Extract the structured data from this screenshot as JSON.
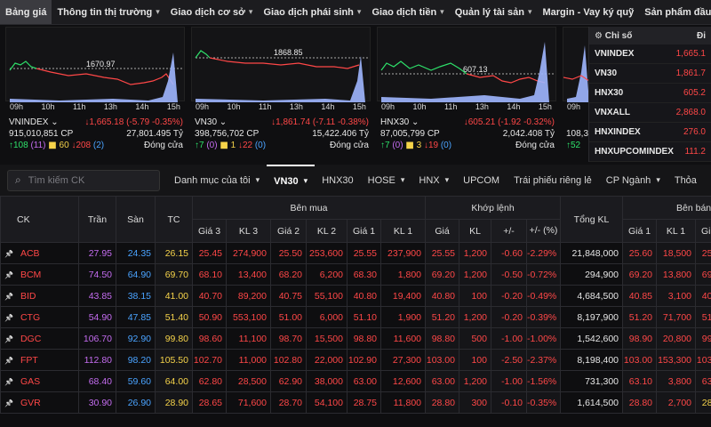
{
  "nav": [
    {
      "label": "Bảng giá",
      "active": true,
      "chevron": false
    },
    {
      "label": "Thông tin thị trường",
      "chevron": true
    },
    {
      "label": "Giao dịch cơ sở",
      "chevron": true
    },
    {
      "label": "Giao dịch phái sinh",
      "chevron": true
    },
    {
      "label": "Giao dịch tiền",
      "chevron": true
    },
    {
      "label": "Quản lý tài sản",
      "chevron": true
    },
    {
      "label": "Margin - Vay ký quỹ",
      "chevron": false
    },
    {
      "label": "Sản phẩm đầu tư",
      "chevron": false
    }
  ],
  "panels": [
    {
      "name": "VNINDEX",
      "ref_label": "1670.97",
      "change": "↓1,665.18 (-5.79 -0.35%)",
      "volume": "915,010,851 CP",
      "value": "27,801.495 Tỷ",
      "adv": "↑108",
      "adv_ceiling": "(11)",
      "unch": "60",
      "dec": "↓208",
      "dec_floor": "(2)",
      "status": "Đóng cửa",
      "times": [
        "09h",
        "10h",
        "11h",
        "13h",
        "14h",
        "15h"
      ]
    },
    {
      "name": "VN30",
      "ref_label": "1868.85",
      "change": "↓1,861.74 (-7.11 -0.38%)",
      "volume": "398,756,702 CP",
      "value": "15,422.406 Tỷ",
      "adv": "↑7",
      "adv_ceiling": "(0)",
      "unch": "1",
      "dec": "↓22",
      "dec_floor": "(0)",
      "status": "Đóng cửa",
      "times": [
        "09h",
        "10h",
        "11h",
        "13h",
        "14h",
        "15h"
      ]
    },
    {
      "name": "HNX30",
      "ref_label": "607.13",
      "change": "↓605.21 (-1.92 -0.32%)",
      "volume": "87,005,799 CP",
      "value": "2,042.408 Tỷ",
      "adv": "↑7",
      "adv_ceiling": "(0)",
      "unch": "3",
      "dec": "↓19",
      "dec_floor": "(0)",
      "status": "Đóng cửa",
      "times": [
        "09h",
        "10h",
        "11h",
        "13h",
        "14h",
        "15h"
      ]
    },
    {
      "name": "",
      "ref_label": "",
      "change": "",
      "volume": "108,3",
      "value": "",
      "adv": "↑52",
      "adv_ceiling": "",
      "unch": "",
      "dec": "",
      "dec_floor": "",
      "status": "",
      "times": [
        "09h",
        "",
        ""
      ]
    }
  ],
  "side": {
    "header": "Chỉ số",
    "header_right": "Đi",
    "rows": [
      {
        "name": "VNINDEX",
        "value": "1,665.1"
      },
      {
        "name": "VN30",
        "value": "1,861.7"
      },
      {
        "name": "HNX30",
        "value": "605.2"
      },
      {
        "name": "VNXALL",
        "value": "2,868.0"
      },
      {
        "name": "HNXINDEX",
        "value": "276.0"
      },
      {
        "name": "HNXUPCOMINDEX",
        "value": "111.2"
      }
    ]
  },
  "search": {
    "placeholder": "Tìm kiếm CK"
  },
  "tabs": [
    {
      "label": "Danh mục của tôi",
      "chevron": true
    },
    {
      "label": "VN30",
      "chevron": true,
      "active": true
    },
    {
      "label": "HNX30",
      "chevron": false
    },
    {
      "label": "HOSE",
      "chevron": true
    },
    {
      "label": "HNX",
      "chevron": true
    },
    {
      "label": "UPCOM",
      "chevron": false
    },
    {
      "label": "Trái phiếu riêng lẻ",
      "chevron": false
    },
    {
      "label": "CP Ngành",
      "chevron": true
    },
    {
      "label": "Thỏa",
      "chevron": false
    }
  ],
  "table": {
    "group_headers": {
      "ck": "CK",
      "tran": "Trần",
      "san": "Sàn",
      "tc": "TC",
      "buy": "Bên mua",
      "match": "Khớp lệnh",
      "total": "Tổng KL",
      "sell": "Bên bán"
    },
    "sub_headers": [
      "Giá 3",
      "KL 3",
      "Giá 2",
      "KL 2",
      "Giá 1",
      "KL 1",
      "Giá",
      "KL",
      "+/-",
      "+/- (%)",
      "Giá 1",
      "KL 1",
      "Giá 2"
    ],
    "rows": [
      {
        "ck": "ACB",
        "tran": "27.95",
        "san": "24.35",
        "tc": "26.15",
        "b3": "25.45",
        "bk3": "274,900",
        "b2": "25.50",
        "bk2": "253,600",
        "b1": "25.55",
        "bk1": "237,900",
        "p": "25.55",
        "kl": "1,200",
        "ch": "-0.60",
        "pct": "-2.29%",
        "tot": "21,848,000",
        "s1": "25.60",
        "sk1": "18,500",
        "s2": "25.65"
      },
      {
        "ck": "BCM",
        "tran": "74.50",
        "san": "64.90",
        "tc": "69.70",
        "b3": "68.10",
        "bk3": "13,400",
        "b2": "68.20",
        "bk2": "6,200",
        "b1": "68.30",
        "bk1": "1,800",
        "p": "69.20",
        "kl": "1,200",
        "ch": "-0.50",
        "pct": "-0.72%",
        "tot": "294,900",
        "s1": "69.20",
        "sk1": "13,800",
        "s2": "69.30"
      },
      {
        "ck": "BID",
        "tran": "43.85",
        "san": "38.15",
        "tc": "41.00",
        "b3": "40.70",
        "bk3": "89,200",
        "b2": "40.75",
        "bk2": "55,100",
        "b1": "40.80",
        "bk1": "19,400",
        "p": "40.80",
        "kl": "100",
        "ch": "-0.20",
        "pct": "-0.49%",
        "tot": "4,684,500",
        "s1": "40.85",
        "sk1": "3,100",
        "s2": "40.90"
      },
      {
        "ck": "CTG",
        "tran": "54.90",
        "san": "47.85",
        "tc": "51.40",
        "b3": "50.90",
        "bk3": "553,100",
        "b2": "51.00",
        "bk2": "6,000",
        "b1": "51.10",
        "bk1": "1,900",
        "p": "51.20",
        "kl": "1,200",
        "ch": "-0.20",
        "pct": "-0.39%",
        "tot": "8,197,900",
        "s1": "51.20",
        "sk1": "71,700",
        "s2": "51.30"
      },
      {
        "ck": "DGC",
        "tran": "106.70",
        "san": "92.90",
        "tc": "99.80",
        "b3": "98.60",
        "bk3": "11,100",
        "b2": "98.70",
        "bk2": "15,500",
        "b1": "98.80",
        "bk1": "11,600",
        "p": "98.80",
        "kl": "500",
        "ch": "-1.00",
        "pct": "-1.00%",
        "tot": "1,542,600",
        "s1": "98.90",
        "sk1": "20,800",
        "s2": "99.00"
      },
      {
        "ck": "FPT",
        "tran": "112.80",
        "san": "98.20",
        "tc": "105.50",
        "b3": "102.70",
        "bk3": "11,000",
        "b2": "102.80",
        "bk2": "22,000",
        "b1": "102.90",
        "bk1": "27,300",
        "p": "103.00",
        "kl": "100",
        "ch": "-2.50",
        "pct": "-2.37%",
        "tot": "8,198,400",
        "s1": "103.00",
        "sk1": "153,300",
        "s2": "103.10"
      },
      {
        "ck": "GAS",
        "tran": "68.40",
        "san": "59.60",
        "tc": "64.00",
        "b3": "62.80",
        "bk3": "28,500",
        "b2": "62.90",
        "bk2": "38,000",
        "b1": "63.00",
        "bk1": "12,600",
        "p": "63.00",
        "kl": "1,200",
        "ch": "-1.00",
        "pct": "-1.56%",
        "tot": "731,300",
        "s1": "63.10",
        "sk1": "3,800",
        "s2": "63.20"
      },
      {
        "ck": "GVR",
        "tran": "30.90",
        "san": "26.90",
        "tc": "28.90",
        "b3": "28.65",
        "bk3": "71,600",
        "b2": "28.70",
        "bk2": "54,100",
        "b1": "28.75",
        "bk1": "11,800",
        "p": "28.80",
        "kl": "300",
        "ch": "-0.10",
        "pct": "-0.35%",
        "tot": "1,614,500",
        "s1": "28.80",
        "sk1": "2,700",
        "s2": "28.90"
      }
    ]
  },
  "colors": {
    "down": "#ff4747",
    "up": "#2ee06a",
    "ref": "#f6d34a",
    "ceiling": "#c46cf0",
    "floor": "#4aa3ff"
  }
}
